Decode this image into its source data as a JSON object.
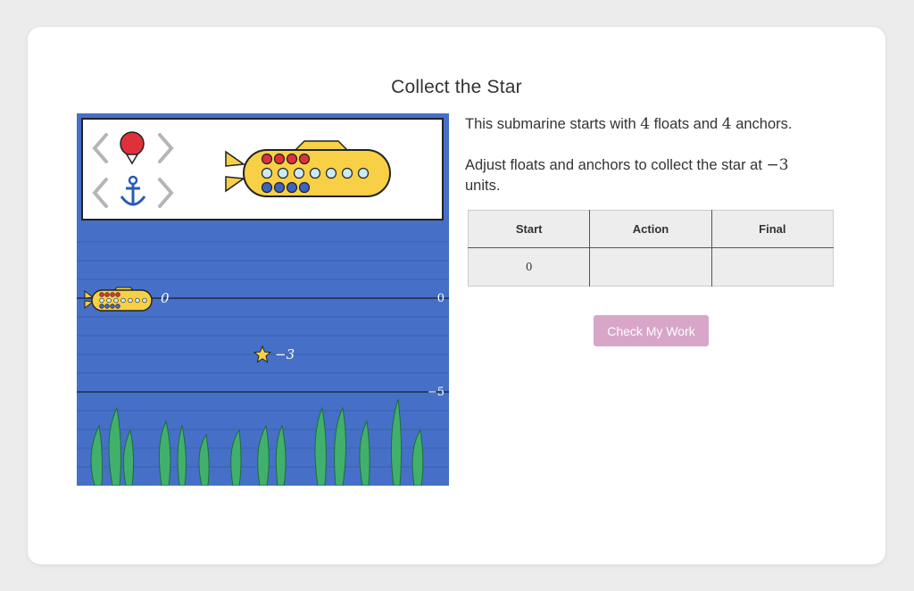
{
  "title": "Collect the Star",
  "prompt": {
    "line1_a": "This submarine starts with ",
    "line1_floats": "4",
    "line1_b": " floats and ",
    "line1_anchors": "4",
    "line1_c": " anchors.",
    "line2_a": "Adjust floats and anchors to collect the star at ",
    "line2_target": "−3",
    "line2_b": "units."
  },
  "controls": {
    "float_icon": "float-buoy-icon",
    "anchor_icon": "anchor-icon",
    "prev_icon": "chevron-left-icon",
    "next_icon": "chevron-right-icon",
    "float_count": 4,
    "anchor_count": 4
  },
  "scene": {
    "submarine_label": "0",
    "star_label": "−3",
    "axis_labels": [
      "0",
      "−5"
    ]
  },
  "table": {
    "headers": [
      "Start",
      "Action",
      "Final"
    ],
    "rows": [
      [
        "0",
        "",
        ""
      ]
    ]
  },
  "check_button": "Check My Work",
  "colors": {
    "water": "#4670c7",
    "submarine": "#f7d046",
    "float": "#e0313a",
    "anchor": "#3b63c6",
    "seaweed": "#3fae6a",
    "button": "#d8a6c8"
  }
}
